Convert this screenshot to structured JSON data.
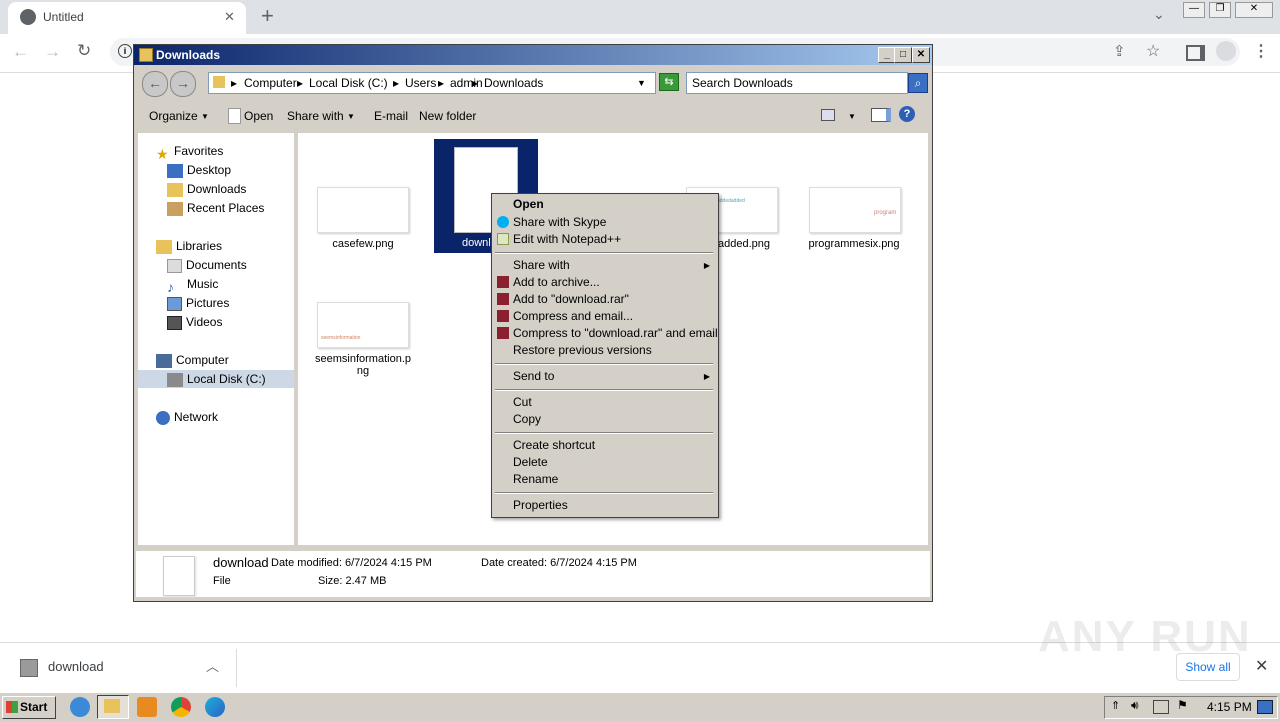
{
  "browser": {
    "tab_title": "Untitled",
    "new_tab": "+",
    "close_tab": "✕"
  },
  "window": {
    "title": "Downloads",
    "breadcrumb": [
      "Computer",
      "Local Disk (C:)",
      "Users",
      "admin",
      "Downloads"
    ],
    "search_placeholder": "Search Downloads"
  },
  "commandbar": {
    "organize": "Organize",
    "open": "Open",
    "share_with": "Share with",
    "email": "E-mail",
    "new_folder": "New folder"
  },
  "navpane": {
    "favorites": "Favorites",
    "desktop": "Desktop",
    "downloads": "Downloads",
    "recent": "Recent Places",
    "libraries": "Libraries",
    "documents": "Documents",
    "music": "Music",
    "pictures": "Pictures",
    "videos": "Videos",
    "computer": "Computer",
    "local_disk": "Local Disk (C:)",
    "network": "Network"
  },
  "files": {
    "casefew": "casefew.png",
    "download_partial": "downl",
    "added_partial": "added.png",
    "programmesix": "programmesix.png",
    "seems_line1": "seemsinformation.p",
    "seems_line2": "ng",
    "thumb_text_added": "addedadded",
    "thumb_text_prog": "program",
    "thumb_text_seems": "seemsinformation"
  },
  "details": {
    "name": "download",
    "type": "File",
    "date_modified": "Date modified: 6/7/2024 4:15 PM",
    "size": "Size: 2.47 MB",
    "date_created": "Date created: 6/7/2024 4:15 PM"
  },
  "context_menu": {
    "open": "Open",
    "skype": "Share with Skype",
    "notepad": "Edit with Notepad++",
    "share_with": "Share with",
    "add_archive": "Add to archive...",
    "add_rar": "Add to \"download.rar\"",
    "compress_email": "Compress and email...",
    "compress_rar_email": "Compress to \"download.rar\" and email",
    "restore": "Restore previous versions",
    "send_to": "Send to",
    "cut": "Cut",
    "copy": "Copy",
    "create_shortcut": "Create shortcut",
    "delete": "Delete",
    "rename": "Rename",
    "properties": "Properties"
  },
  "download_bar": {
    "filename": "download",
    "show_all": "Show all"
  },
  "taskbar": {
    "start": "Start",
    "clock": "4:15 PM"
  },
  "watermark": "ANY RUN"
}
